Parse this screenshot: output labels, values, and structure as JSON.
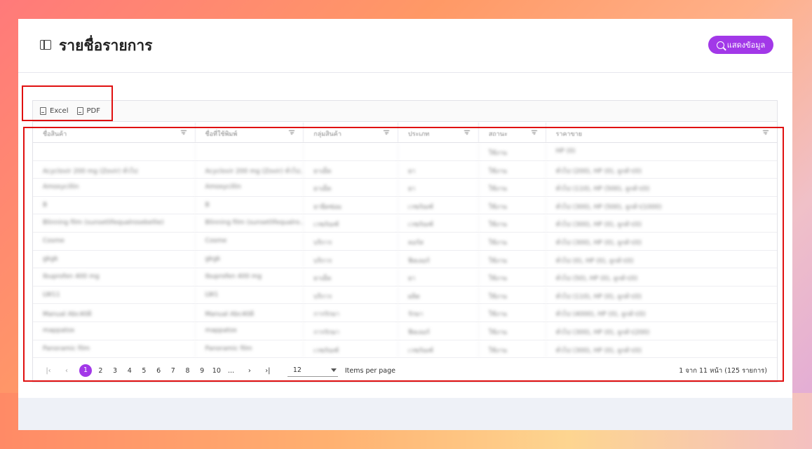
{
  "header": {
    "title": "รายชื่อรายการ",
    "show_button": "แสดงข้อมูล"
  },
  "toolbar": {
    "excel": "Excel",
    "pdf": "PDF"
  },
  "table": {
    "columns": [
      "ชื่อสินค้า",
      "ชื่อที่ใช้พิมพ์",
      "กลุ่มสินค้า",
      "ประเภท",
      "สถานะ",
      "ราคาขาย"
    ],
    "rows": [
      [
        "",
        "",
        "",
        "",
        "ใช้งาน",
        "HP (0)"
      ],
      [
        "Acyclovir 200 mg (Zovir) ทั่วไป",
        "Acyclovir 200 mg (Zovir) ทั่วไป...",
        "ยาเม็ด",
        "ยา",
        "ใช้งาน",
        "ทั่วไป (200), HP (0), ลูกค้า(0)"
      ],
      [
        "Amoxycillin",
        "Amoxycillin",
        "ยาเม็ด",
        "ยา",
        "ใช้งาน",
        "ทั่วไป (110), HP (500), ลูกค้า(0)"
      ],
      [
        "B",
        "B",
        "ยาฉีดซ่อม",
        "เวชภัณฑ์",
        "ใช้งาน",
        "ทั่วไป (300), HP (500), ลูกค้า(1000)"
      ],
      [
        "Blinning film (sunsetlifequalrosebellie)",
        "Blinning film (sunsetlifequalro...",
        "เวชภัณฑ์",
        "เวชภัณฑ์",
        "ใช้งาน",
        "ทั่วไป (300), HP (0), ลูกค้า(0)"
      ],
      [
        "Cosme",
        "Cosme",
        "บริการ",
        "คอร์ส",
        "ใช้งาน",
        "ทั่วไป (300), HP (0), ลูกค้า(0)"
      ],
      [
        "gkgk",
        "gkgk",
        "บริการ",
        "ฟิลเลอร์",
        "ใช้งาน",
        "ทั่วไป (0), HP (0), ลูกค้า(0)"
      ],
      [
        "Ibuprofen 400 mg",
        "Ibuprofen 400 mg",
        "ยาเม็ด",
        "ยา",
        "ใช้งาน",
        "ทั่วไป (50), HP (0), ลูกค้า(0)"
      ],
      [
        "LW11",
        "LW1",
        "บริการ",
        "ผลิต",
        "ใช้งาน",
        "ทั่วไป (110), HP (0), ลูกค้า(0)"
      ],
      [
        "Manual Abc40ดิ",
        "Manual Abc40ดิ",
        "การรักษา",
        "รักษา",
        "ใช้งาน",
        "ทั่วไป (4000), HP (0), ลูกค้า(0)"
      ],
      [
        "mappatox",
        "mappatox",
        "การรักษา",
        "ฟิลเลอร์",
        "ใช้งาน",
        "ทั่วไป (300), HP (0), ลูกค้า(200)"
      ],
      [
        "Panoramic film",
        "Panoramic film",
        "เวชภัณฑ์",
        "เวชภัณฑ์",
        "ใช้งาน",
        "ทั่วไป (300), HP (0), ลูกค้า(0)"
      ]
    ]
  },
  "pager": {
    "first": "|‹",
    "prev": "‹",
    "pages": [
      "1",
      "2",
      "3",
      "4",
      "5",
      "6",
      "7",
      "8",
      "9",
      "10",
      "..."
    ],
    "next": "›",
    "last": "›|",
    "page_size": "12",
    "items_per_page": "Items per page",
    "summary": "1 จาก 11 หน้า (125 รายการ)"
  },
  "colors": {
    "accent": "#a238e8",
    "highlight": "#e01010"
  }
}
